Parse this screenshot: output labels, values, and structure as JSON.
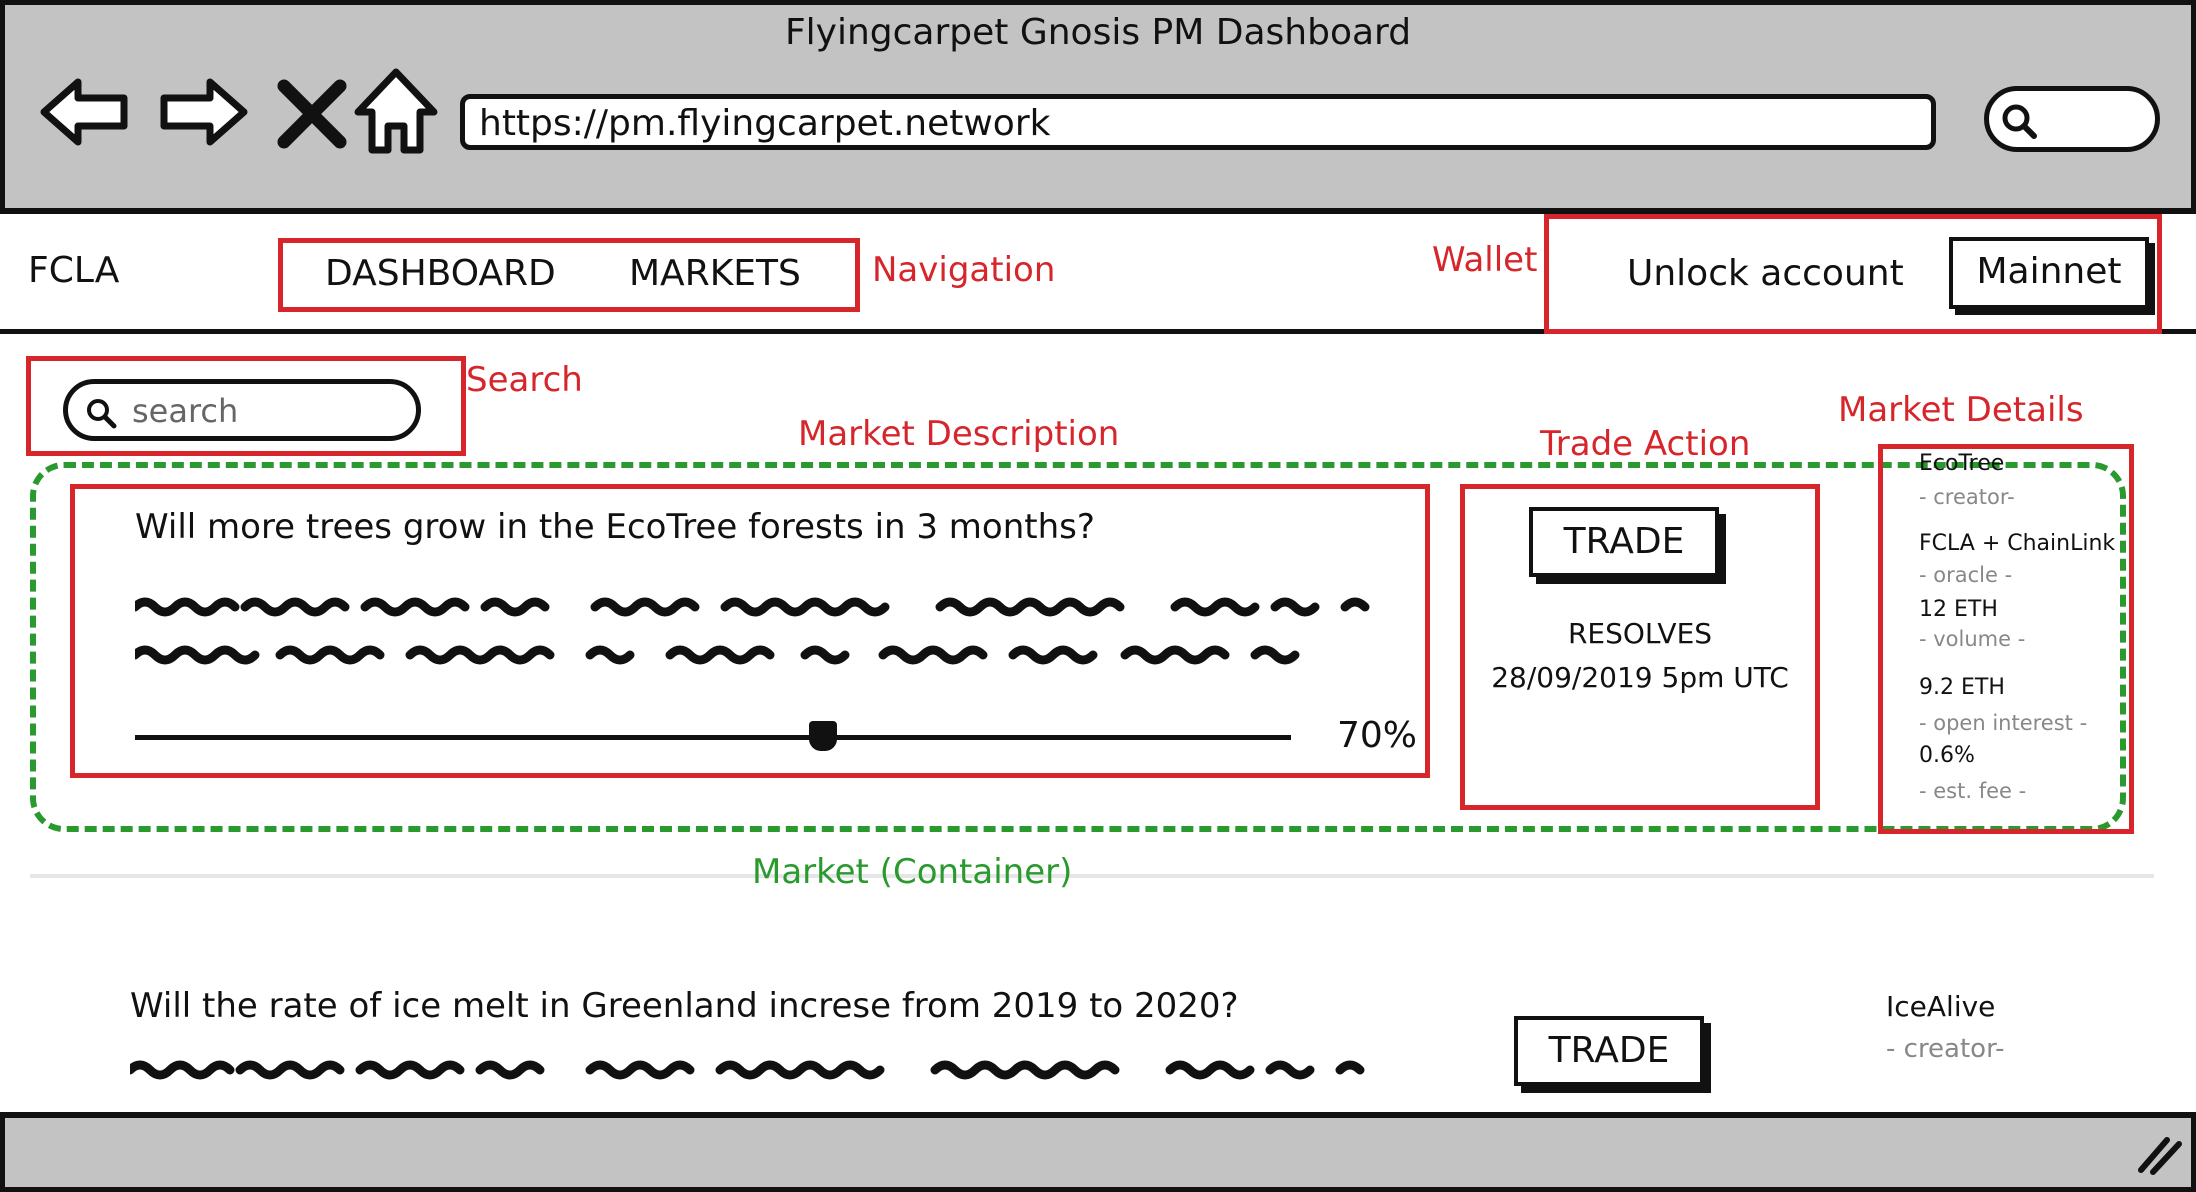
{
  "browser": {
    "window_title": "Flyingcarpet Gnosis PM Dashboard",
    "url": "https://pm.flyingcarpet.network",
    "icons": [
      "back-arrow-icon",
      "forward-arrow-icon",
      "close-x-icon",
      "home-icon",
      "search-icon",
      "resize-grip-icon"
    ]
  },
  "header": {
    "brand": "FCLA",
    "nav": [
      "DASHBOARD",
      "MARKETS"
    ],
    "wallet": {
      "unlock_label": "Unlock account",
      "network_label": "Mainnet"
    }
  },
  "search": {
    "placeholder": "search"
  },
  "annotations": {
    "navigation": "Navigation",
    "wallet": "Wallet",
    "search": "Search",
    "market_description": "Market Description",
    "trade_action": "Trade Action",
    "market_details": "Market Details",
    "market_container": "Market (Container)"
  },
  "markets": [
    {
      "question": "Will more trees grow in the EcoTree forests in 3 months?",
      "probability": "70%",
      "probability_value": 0.7,
      "trade_label": "TRADE",
      "resolves_label": "RESOLVES",
      "resolves_date": "28/09/2019 5pm UTC",
      "details": {
        "creator": "EcoTree",
        "creator_label": "- creator-",
        "oracle": "FCLA + ChainLink",
        "oracle_label": "- oracle -",
        "volume": "12 ETH",
        "volume_label": "- volume -",
        "open_interest": "9.2 ETH",
        "open_interest_label": "- open interest -",
        "fee": "0.6%",
        "fee_label": "- est. fee -"
      }
    },
    {
      "question": "Will the rate of ice melt in Greenland increse from 2019 to 2020?",
      "trade_label": "TRADE",
      "details": {
        "creator": "IceAlive",
        "creator_label": "- creator-"
      }
    }
  ],
  "colors": {
    "chrome_gray": "#c3c3c3",
    "annotation_red": "#d6262b",
    "container_green": "#2a9a2f",
    "ink": "#111111"
  }
}
